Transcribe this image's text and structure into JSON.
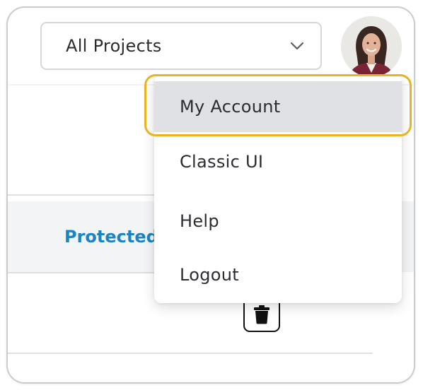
{
  "header": {
    "project_select": {
      "value": "All Projects",
      "chevron_icon": "chevron-down-icon"
    },
    "avatar": {
      "icon": "user-avatar"
    }
  },
  "user_menu": {
    "items": [
      {
        "label": "My Account",
        "state": "highlighted"
      },
      {
        "label": "Classic UI"
      },
      {
        "label": "Help"
      },
      {
        "label": "Logout"
      }
    ],
    "highlight_color": "#e8b423"
  },
  "table": {
    "row": {
      "protected_link": "Protected",
      "delete_icon": "trash-icon"
    }
  },
  "colors": {
    "link": "#1b84c6",
    "row_bg": "#f3f4f6",
    "menu_active_bg": "#dfe1e5"
  }
}
